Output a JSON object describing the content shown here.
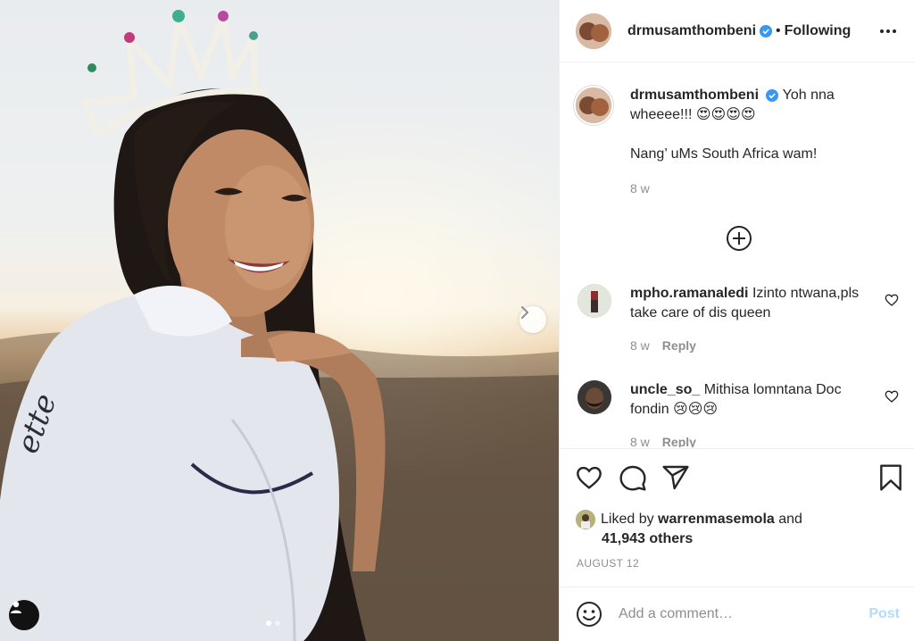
{
  "post": {
    "author": "drmusamthombeni",
    "follow_state": "Following",
    "separator": "•",
    "caption_part1": "Yoh nna wheeee!!! 😍😍😍😍",
    "caption_part2": "Nang’ uMs South Africa wam!",
    "caption_age": "8 w",
    "date": "AUGUST 12"
  },
  "comments": [
    {
      "username": "mpho.ramanaledi",
      "text": "Izinto ntwana,pls take care of dis queen",
      "age": "8 w",
      "reply_label": "Reply"
    },
    {
      "username": "uncle_so_",
      "text": "Mithisa lomntana Doc fondin 😢😢😢",
      "age": "8 w",
      "reply_label": "Reply"
    }
  ],
  "likes": {
    "prefix": "Liked by",
    "liker": "warrenmasemola",
    "and": "and",
    "others": "41,943 others"
  },
  "add_comment": {
    "placeholder": "Add a comment…",
    "post_label": "Post"
  },
  "carousel": {
    "current": 1,
    "total": 2
  },
  "colors": {
    "verified": "#3897f0",
    "post_disabled": "#b3dbff",
    "muted": "#8e8e8e"
  },
  "icons": [
    "verified-icon",
    "more-options-icon",
    "add-circle-icon",
    "heart-icon",
    "comment-icon",
    "share-icon",
    "bookmark-icon",
    "emoji-icon",
    "chevron-right-icon",
    "user-tag-icon"
  ]
}
